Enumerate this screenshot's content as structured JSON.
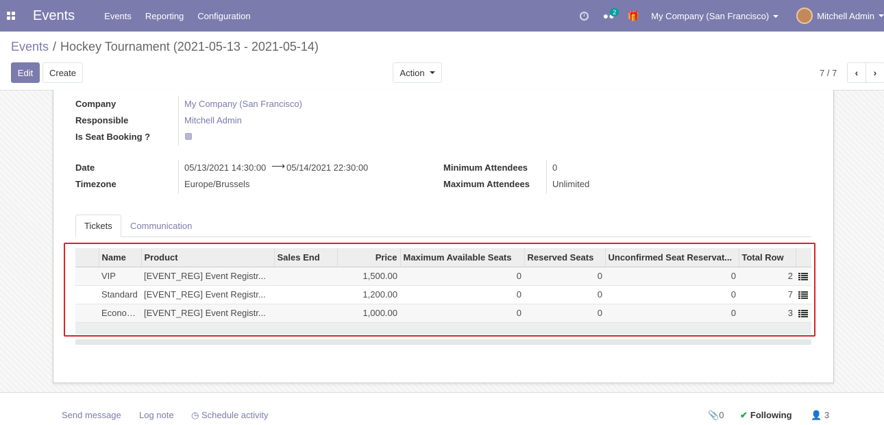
{
  "navbar": {
    "app_title": "Events",
    "menu": [
      "Events",
      "Reporting",
      "Configuration"
    ],
    "messages_badge": "2",
    "company": "My Company (San Francisco)",
    "user": "Mitchell Admin",
    "bg_color": "#7c7bad"
  },
  "breadcrumb": {
    "parent": "Events",
    "separator": "/",
    "current": "Hockey Tournament (2021-05-13 - 2021-05-14)"
  },
  "buttons": {
    "edit": "Edit",
    "create": "Create",
    "action": "Action"
  },
  "pager": {
    "text": "7 / 7"
  },
  "form": {
    "company_label": "Company",
    "company_value": "My Company (San Francisco)",
    "responsible_label": "Responsible",
    "responsible_value": "Mitchell Admin",
    "seat_booking_label": "Is Seat Booking ?",
    "seat_booking_checked": true,
    "date_label": "Date",
    "date_start": "05/13/2021 14:30:00",
    "date_end": "05/14/2021 22:30:00",
    "timezone_label": "Timezone",
    "timezone_value": "Europe/Brussels",
    "min_attendees_label": "Minimum Attendees",
    "min_attendees_value": "0",
    "max_attendees_label": "Maximum Attendees",
    "max_attendees_value": "Unlimited"
  },
  "tabs": [
    {
      "label": "Tickets",
      "active": true
    },
    {
      "label": "Communication",
      "active": false
    }
  ],
  "tickets": {
    "columns": [
      "Name",
      "Product",
      "Sales End",
      "Price",
      "Maximum Available Seats",
      "Reserved Seats",
      "Unconfirmed Seat Reservat...",
      "Total Row"
    ],
    "rows": [
      {
        "name": "VIP",
        "product": "[EVENT_REG] Event Registr...",
        "sales_end": "",
        "price": "1,500.00",
        "max_seats": "0",
        "reserved": "0",
        "unconfirmed": "0",
        "total_row": "2"
      },
      {
        "name": "Standard",
        "product": "[EVENT_REG] Event Registr...",
        "sales_end": "",
        "price": "1,200.00",
        "max_seats": "0",
        "reserved": "0",
        "unconfirmed": "0",
        "total_row": "7"
      },
      {
        "name": "Economy",
        "product": "[EVENT_REG] Event Registr...",
        "sales_end": "",
        "price": "1,000.00",
        "max_seats": "0",
        "reserved": "0",
        "unconfirmed": "0",
        "total_row": "3"
      }
    ]
  },
  "chatter": {
    "send_message": "Send message",
    "log_note": "Log note",
    "schedule_activity": "Schedule activity",
    "attachments": "0",
    "following": "Following",
    "followers": "3"
  }
}
